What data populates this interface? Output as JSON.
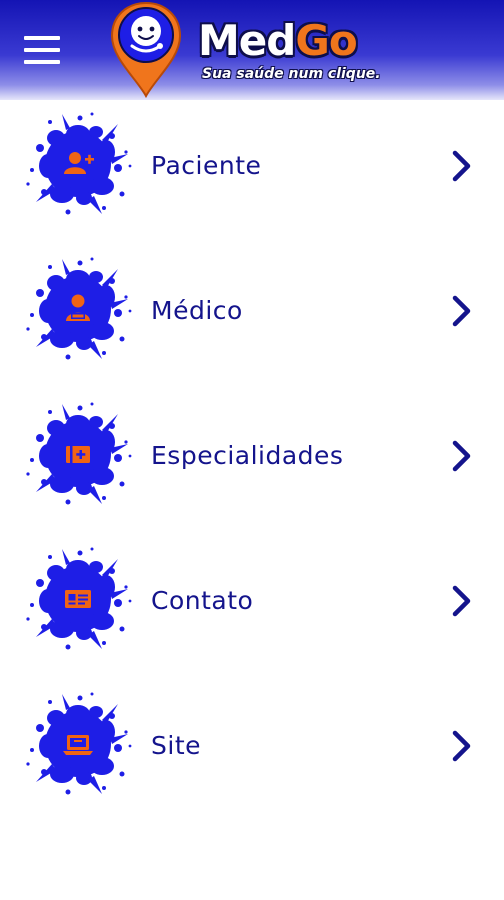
{
  "header": {
    "menu_icon": "hamburger-menu-icon",
    "logo_icon": "map-pin-mascot-icon",
    "brand_primary": "Med",
    "brand_accent": "Go",
    "tagline": "Sua saúde num clique.",
    "colors": {
      "bar_top": "#1414b4",
      "brand_text": "#ffffff",
      "brand_accent": "#f0751c"
    }
  },
  "menu": {
    "items": [
      {
        "label": "Paciente",
        "icon": "patient-icon"
      },
      {
        "label": "Médico",
        "icon": "doctor-icon"
      },
      {
        "label": "Especialidades",
        "icon": "medical-kit-icon"
      },
      {
        "label": "Contato",
        "icon": "contact-card-icon"
      },
      {
        "label": "Site",
        "icon": "laptop-icon"
      }
    ],
    "chevron_icon": "chevron-right-icon",
    "colors": {
      "label": "#14148c",
      "splat": "#1e1ee6",
      "icon": "#f06414",
      "chevron": "#14148c"
    }
  }
}
